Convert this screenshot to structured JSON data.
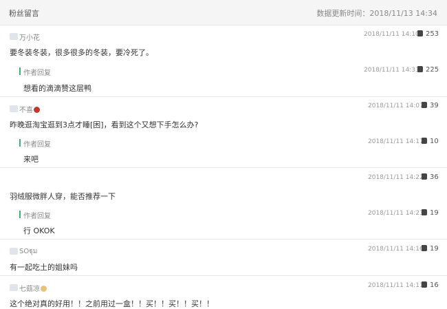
{
  "header": {
    "title": "粉丝留言",
    "update_label": "数据更新时间：2018/11/13 14:34"
  },
  "reply_label": "作者回复",
  "comments": [
    {
      "nickname": "万小花",
      "time": "2018/11/11 14:10",
      "likes": "253",
      "text": "要冬装冬装，很多很多的冬装，要冷死了。",
      "reply": {
        "time": "2018/11/11 14:33",
        "likes": "225",
        "text": "想看的滴滴赞这层鸭"
      }
    },
    {
      "nickname": "不喜",
      "time": "2018/11/11 14:07",
      "likes": "39",
      "text": "昨晚逛淘宝逛到3点才睡[困]，看到这个又想下手怎么办?",
      "reply": {
        "time": "2018/11/11 14:17",
        "likes": "10",
        "text": "来吧"
      }
    },
    {
      "nickname": "",
      "time": "2018/11/11 14:22",
      "likes": "36",
      "text": "羽绒服微胖人穿，能否推荐一下",
      "reply": {
        "time": "2018/11/11 14:23",
        "likes": "19",
        "text": "行 OKOK"
      }
    },
    {
      "nickname": "SOฐุม",
      "time": "2018/11/11 14:16",
      "likes": "19",
      "text": "有一起吃土的姐妹吗"
    },
    {
      "nickname": "七菇凉",
      "time": "2018/11/11 14:11",
      "likes": "16",
      "text": "这个绝对真的好用！！之前用过一盒！！买！！买！！买！！"
    }
  ]
}
